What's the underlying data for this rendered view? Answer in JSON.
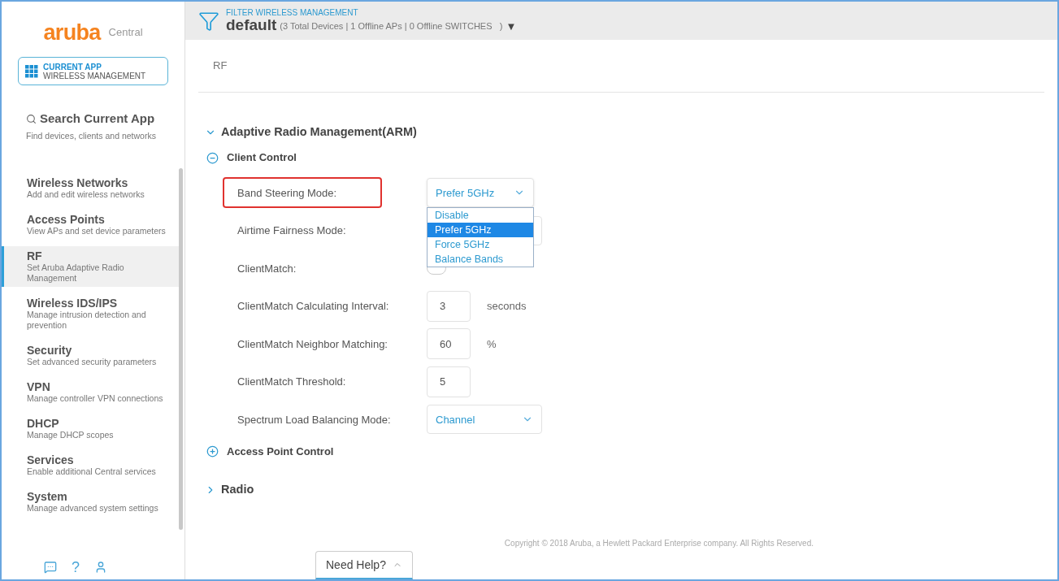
{
  "logo": {
    "brand": "aruba",
    "product": "Central"
  },
  "current_app": {
    "title": "CURRENT APP",
    "name": "WIRELESS MANAGEMENT"
  },
  "search": {
    "title": "Search Current App",
    "hint": "Find devices, clients and networks"
  },
  "sidebar": {
    "items": [
      {
        "title": "Wireless Networks",
        "subtitle": "Add and edit wireless networks",
        "selected": false
      },
      {
        "title": "Access Points",
        "subtitle": "View APs and set device parameters",
        "selected": false
      },
      {
        "title": "RF",
        "subtitle": "Set Aruba Adaptive Radio Management",
        "selected": true
      },
      {
        "title": "Wireless IDS/IPS",
        "subtitle": "Manage intrusion detection and prevention",
        "selected": false
      },
      {
        "title": "Security",
        "subtitle": "Set advanced security parameters",
        "selected": false
      },
      {
        "title": "VPN",
        "subtitle": "Manage controller VPN connections",
        "selected": false
      },
      {
        "title": "DHCP",
        "subtitle": "Manage DHCP scopes",
        "selected": false
      },
      {
        "title": "Services",
        "subtitle": "Enable additional Central services",
        "selected": false
      },
      {
        "title": "System",
        "subtitle": "Manage advanced system settings",
        "selected": false
      }
    ],
    "footer_icons": [
      "?"
    ]
  },
  "filter": {
    "label": "FILTER WIRELESS MANAGEMENT",
    "group": "default",
    "summary": "(3 Total Devices | 1 Offline APs | 0 Offline SWITCHES   )",
    "caret": "▼"
  },
  "page_title": "RF",
  "section": {
    "title": "Adaptive Radio Management(ARM)",
    "expanded": true,
    "groups": [
      {
        "title": "Client Control",
        "expanded": true,
        "fields": [
          {
            "kind": "select",
            "label": "Band Steering Mode:",
            "value": "Prefer 5GHz",
            "highlighted": true,
            "open": true,
            "options": [
              {
                "label": "Disable",
                "selected": false
              },
              {
                "label": "Prefer 5GHz",
                "selected": true
              },
              {
                "label": "Force 5GHz",
                "selected": false
              },
              {
                "label": "Balance Bands",
                "selected": false
              }
            ]
          },
          {
            "kind": "select",
            "label": "Airtime Fairness Mode:",
            "highlighted": false,
            "open": false
          },
          {
            "kind": "toggle",
            "label": "ClientMatch:",
            "on": false,
            "highlighted": false
          },
          {
            "kind": "number",
            "label": "ClientMatch Calculating Interval:",
            "value": "3",
            "unit": "seconds",
            "highlighted": false
          },
          {
            "kind": "number",
            "label": "ClientMatch Neighbor Matching:",
            "value": "60",
            "unit": "%",
            "highlighted": false
          },
          {
            "kind": "number",
            "label": "ClientMatch Threshold:",
            "value": "5",
            "highlighted": false
          },
          {
            "kind": "select",
            "label": "Spectrum Load Balancing Mode:",
            "value": "Channel",
            "highlighted": false,
            "open": false
          }
        ]
      },
      {
        "title": "Access Point Control",
        "expanded": false
      }
    ]
  },
  "section_2": {
    "title": "Radio",
    "expanded": false
  },
  "copyright": "Copyright © 2018 Aruba, a Hewlett Packard Enterprise company. All Rights Reserved.",
  "help_button": "Need Help?"
}
